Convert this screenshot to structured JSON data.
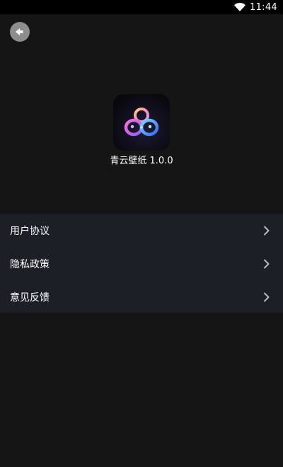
{
  "status_bar": {
    "time": "11:44",
    "icons": [
      "wifi-icon"
    ]
  },
  "header": {
    "back_icon": "back-arrow-icon"
  },
  "app": {
    "name_version": "青云壁纸 1.0.0",
    "logo_icon": "app-logo-rings-icon"
  },
  "menu": {
    "items": [
      {
        "label": "用户协议",
        "icon": "chevron-right-icon"
      },
      {
        "label": "隐私政策",
        "icon": "chevron-right-icon"
      },
      {
        "label": "意见反馈",
        "icon": "chevron-right-icon"
      }
    ]
  },
  "colors": {
    "background": "#151515",
    "status_bar": "#000000",
    "menu_background": "#1c1f26",
    "back_button": "#8d8d8d",
    "text": "#ffffff",
    "chevron": "#b9b9b9"
  }
}
